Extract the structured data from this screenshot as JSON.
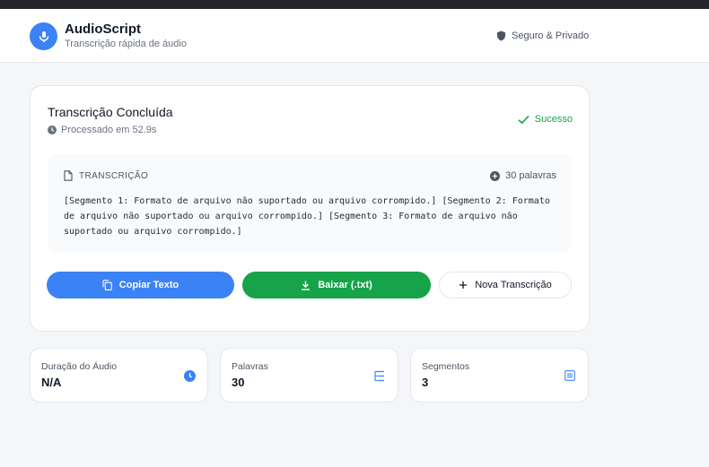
{
  "app": {
    "title": "AudioScript",
    "subtitle": "Transcrição rápida de áudio",
    "secure_label": "Seguro & Privado",
    "logo_icon": "microphone-icon",
    "accent_color": "#3b82f6"
  },
  "result": {
    "title": "Transcrição Concluída",
    "processed_label": "Processado em 52.9s",
    "status_label": "Sucesso",
    "status_color": "#16a34a"
  },
  "transcription": {
    "section_label": "TRANSCRIÇÃO",
    "word_count_label": "30 palavras",
    "text": "[Segmento 1: Formato de arquivo não suportado ou arquivo corrompido.] [Segmento 2: Formato de arquivo não suportado ou arquivo corrompido.] [Segmento 3: Formato de arquivo não suportado ou arquivo corrompido.]"
  },
  "actions": {
    "copy_label": "Copiar Texto",
    "download_label": "Baixar (.txt)",
    "new_label": "Nova Transcrição",
    "copy_color": "#3b82f6",
    "download_color": "#16a34a"
  },
  "stats": [
    {
      "label": "Duração do Áudio",
      "value": "N/A",
      "icon": "clock-icon"
    },
    {
      "label": "Palavras",
      "value": "30",
      "icon": "list-icon"
    },
    {
      "label": "Segmentos",
      "value": "3",
      "icon": "document-lines-icon"
    }
  ]
}
